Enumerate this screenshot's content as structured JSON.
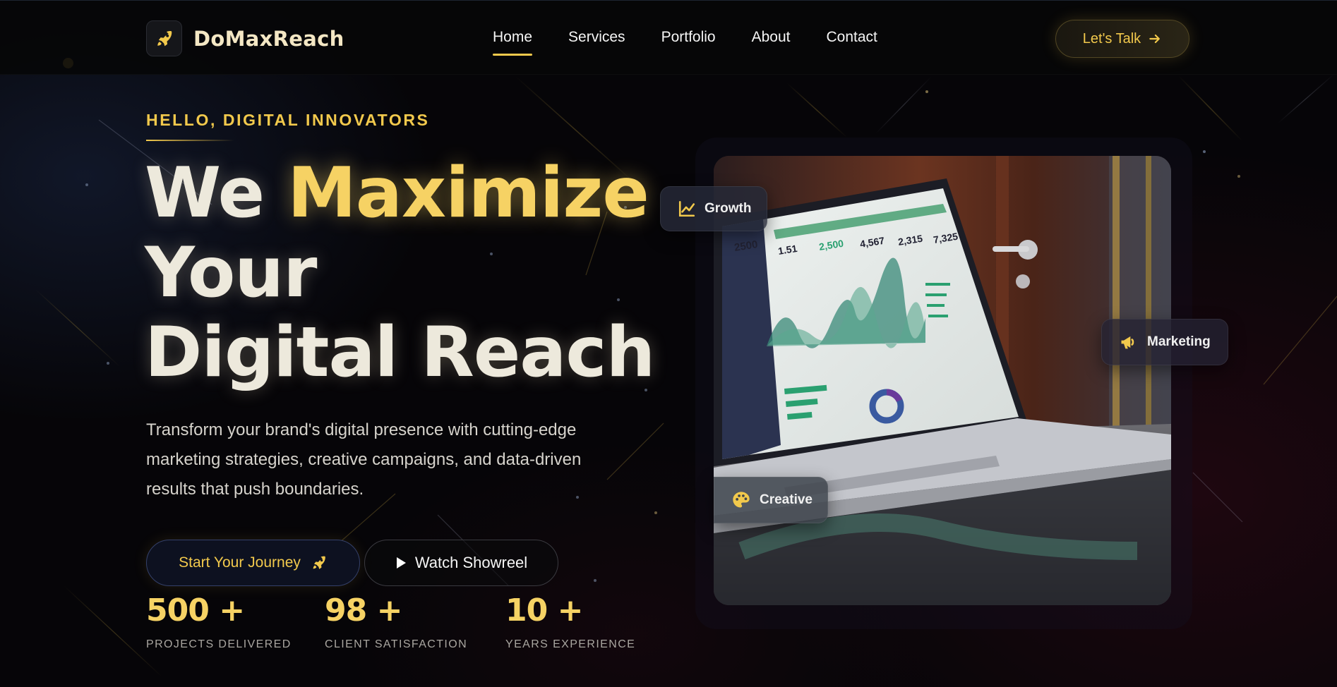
{
  "brand": {
    "name": "DoMaxReach",
    "logo_icon": "rocket-icon",
    "accent": "#f2c94c"
  },
  "nav": {
    "items": [
      {
        "label": "Home",
        "active": true
      },
      {
        "label": "Services",
        "active": false
      },
      {
        "label": "Portfolio",
        "active": false
      },
      {
        "label": "About",
        "active": false
      },
      {
        "label": "Contact",
        "active": false
      }
    ],
    "cta_label": "Let's Talk",
    "cta_icon": "arrow-right-icon"
  },
  "hero": {
    "eyebrow": "HELLO, DIGITAL INNOVATORS",
    "headline": {
      "word1": "We",
      "word2": "Maximize",
      "line2": "Your",
      "line3": "Digital Reach"
    },
    "description": "Transform your brand's digital presence with cutting-edge marketing strategies, creative campaigns, and data-driven results that push boundaries.",
    "primary_button": {
      "label": "Start Your Journey",
      "icon": "rocket-icon"
    },
    "secondary_button": {
      "label": "Watch Showreel",
      "icon": "play-icon"
    }
  },
  "stats": [
    {
      "number": "500",
      "suffix": "+",
      "label": "PROJECTS DELIVERED"
    },
    {
      "number": "98",
      "suffix": "+",
      "label": "CLIENT SATISFACTION"
    },
    {
      "number": "10",
      "suffix": "+",
      "label": "YEARS EXPERIENCE"
    }
  ],
  "visual": {
    "image_subject": "laptop showing analytics dashboard",
    "dashboard_numbers": [
      "2500",
      "1.51",
      "2,500",
      "4,567",
      "2,315",
      "7,325"
    ],
    "badges": [
      {
        "label": "Growth",
        "icon": "chart-line-icon"
      },
      {
        "label": "Marketing",
        "icon": "megaphone-icon"
      },
      {
        "label": "Creative",
        "icon": "palette-icon"
      }
    ]
  }
}
